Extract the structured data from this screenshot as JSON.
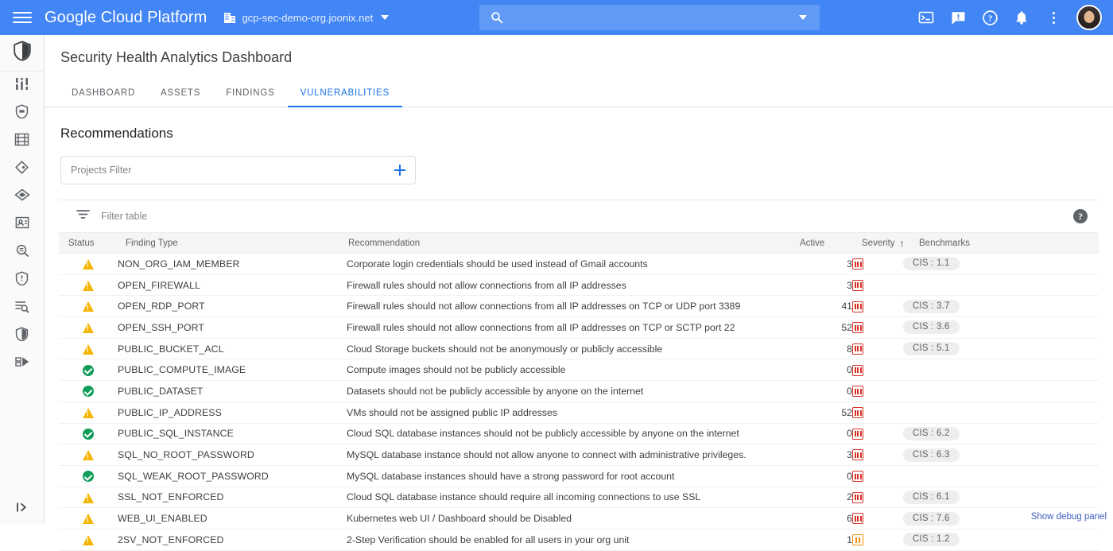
{
  "topbar": {
    "menu_icon": "hamburger-menu-icon",
    "brand": "Google Cloud Platform",
    "project_icon": "org-building-icon",
    "project": "gcp-sec-demo-org.joonix.net",
    "project_caret": "chevron-down-icon",
    "search": {
      "value": "",
      "placeholder": "",
      "icon": "search-icon",
      "caret": "chevron-down-icon"
    },
    "actions": [
      {
        "name": "cloud-shell-icon",
        "label": "Activate Cloud Shell"
      },
      {
        "name": "feedback-icon",
        "label": "Send feedback"
      },
      {
        "name": "help-icon",
        "label": "Help"
      },
      {
        "name": "notifications-bell-icon",
        "label": "Notifications"
      },
      {
        "name": "more-kebab-icon",
        "label": "More options"
      },
      {
        "name": "avatar",
        "label": "Account"
      }
    ],
    "accent": "#4285f4"
  },
  "rail": {
    "pinned_icon": "shield-security-command-center-icon",
    "items": [
      {
        "icon": "dashboard-bars-icon",
        "label": "Dashboard"
      },
      {
        "icon": "shield-small-icon",
        "label": "Security"
      },
      {
        "icon": "asset-inventory-icon",
        "label": "Assets"
      },
      {
        "icon": "findings-diamond-icon",
        "label": "Findings"
      },
      {
        "icon": "sources-hexagon-icon",
        "label": "Sources"
      },
      {
        "icon": "identity-card-icon",
        "label": "Identity"
      },
      {
        "icon": "magnifier-scan-icon",
        "label": "Scanner"
      },
      {
        "icon": "shield-warning-icon",
        "label": "Vulnerabilities"
      },
      {
        "icon": "document-search-icon",
        "label": "Audit"
      },
      {
        "icon": "shield-check-icon",
        "label": "Compliance"
      },
      {
        "icon": "data-export-icon",
        "label": "Export"
      }
    ],
    "expand_icon": "expand-panel-icon"
  },
  "page": {
    "title": "Security Health Analytics Dashboard",
    "tabs": [
      {
        "label": "DASHBOARD",
        "active": false
      },
      {
        "label": "ASSETS",
        "active": false
      },
      {
        "label": "FINDINGS",
        "active": false
      },
      {
        "label": "VULNERABILITIES",
        "active": true
      }
    ],
    "section_title": "Recommendations",
    "projects_filter": {
      "placeholder": "Projects Filter",
      "value": "",
      "add_icon": "plus-icon"
    },
    "filter_table": {
      "icon": "filter-funnel-icon",
      "placeholder": "Filter table"
    },
    "table_help_icon": "help-circle-icon",
    "debug_link": "Show debug panel",
    "accent_blue": "#1a73e8",
    "severity_critical_color": "#d93025",
    "severity_medium_color": "#ef8f00",
    "status_warning_color": "#f5b400",
    "status_ok_color": "#0f9d58"
  },
  "table": {
    "columns": [
      {
        "key": "status",
        "label": "Status",
        "sorted": false
      },
      {
        "key": "finding_type",
        "label": "Finding Type",
        "sorted": false
      },
      {
        "key": "recommendation",
        "label": "Recommendation",
        "sorted": false
      },
      {
        "key": "active",
        "label": "Active",
        "sorted": false
      },
      {
        "key": "severity",
        "label": "Severity",
        "sorted": true,
        "sort_dir": "↑"
      },
      {
        "key": "benchmarks",
        "label": "Benchmarks",
        "sorted": false
      }
    ],
    "rows": [
      {
        "status": "warning",
        "finding_type": "NON_ORG_IAM_MEMBER",
        "recommendation": "Corporate login credentials should be used instead of Gmail accounts",
        "active": "3",
        "severity": "critical",
        "benchmark": "CIS : 1.1"
      },
      {
        "status": "warning",
        "finding_type": "OPEN_FIREWALL",
        "recommendation": "Firewall rules should not allow connections from all IP addresses",
        "active": "3",
        "severity": "critical",
        "benchmark": ""
      },
      {
        "status": "warning",
        "finding_type": "OPEN_RDP_PORT",
        "recommendation": "Firewall rules should not allow connections from all IP addresses on TCP or UDP port 3389",
        "active": "41",
        "severity": "critical",
        "benchmark": "CIS : 3.7"
      },
      {
        "status": "warning",
        "finding_type": "OPEN_SSH_PORT",
        "recommendation": "Firewall rules should not allow connections from all IP addresses on TCP or SCTP port 22",
        "active": "52",
        "severity": "critical",
        "benchmark": "CIS : 3.6"
      },
      {
        "status": "warning",
        "finding_type": "PUBLIC_BUCKET_ACL",
        "recommendation": "Cloud Storage buckets should not be anonymously or publicly accessible",
        "active": "8",
        "severity": "critical",
        "benchmark": "CIS : 5.1"
      },
      {
        "status": "ok",
        "finding_type": "PUBLIC_COMPUTE_IMAGE",
        "recommendation": "Compute images should not be publicly accessible",
        "active": "0",
        "severity": "critical",
        "benchmark": ""
      },
      {
        "status": "ok",
        "finding_type": "PUBLIC_DATASET",
        "recommendation": "Datasets should not be publicly accessible by anyone on the internet",
        "active": "0",
        "severity": "critical",
        "benchmark": ""
      },
      {
        "status": "warning",
        "finding_type": "PUBLIC_IP_ADDRESS",
        "recommendation": "VMs should not be assigned public IP addresses",
        "active": "52",
        "severity": "critical",
        "benchmark": ""
      },
      {
        "status": "ok",
        "finding_type": "PUBLIC_SQL_INSTANCE",
        "recommendation": "Cloud SQL database instances should not be publicly accessible by anyone on the internet",
        "active": "0",
        "severity": "critical",
        "benchmark": "CIS : 6.2"
      },
      {
        "status": "warning",
        "finding_type": "SQL_NO_ROOT_PASSWORD",
        "recommendation": "MySQL database instance should not allow anyone to connect with administrative privileges.",
        "active": "3",
        "severity": "critical",
        "benchmark": "CIS : 6.3"
      },
      {
        "status": "ok",
        "finding_type": "SQL_WEAK_ROOT_PASSWORD",
        "recommendation": "MySQL database instances should have a strong password for root account",
        "active": "0",
        "severity": "critical",
        "benchmark": ""
      },
      {
        "status": "warning",
        "finding_type": "SSL_NOT_ENFORCED",
        "recommendation": "Cloud SQL database instance should require all incoming connections to use SSL",
        "active": "2",
        "severity": "critical",
        "benchmark": "CIS : 6.1"
      },
      {
        "status": "warning",
        "finding_type": "WEB_UI_ENABLED",
        "recommendation": "Kubernetes web UI / Dashboard should be Disabled",
        "active": "6",
        "severity": "critical",
        "benchmark": "CIS : 7.6"
      },
      {
        "status": "warning",
        "finding_type": "2SV_NOT_ENFORCED",
        "recommendation": "2-Step Verification should be enabled for all users in your org unit",
        "active": "1",
        "severity": "medium",
        "benchmark": "CIS : 1.2"
      }
    ]
  }
}
